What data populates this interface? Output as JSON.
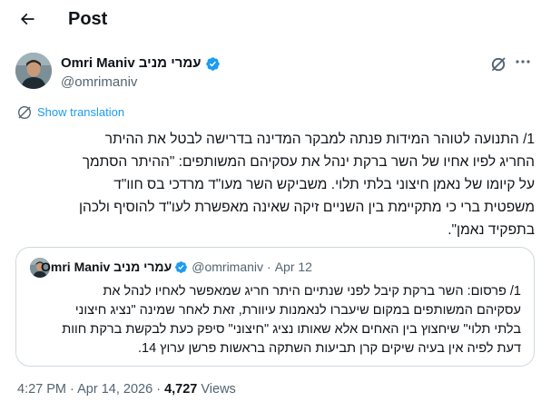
{
  "header": {
    "title": "Post"
  },
  "author": {
    "display_name": "Omri Maniv עמרי מניב",
    "handle": "@omrimaniv"
  },
  "translate_label": "Show translation",
  "tweet": {
    "lines": [
      "1/ התנועה לטוהר המידות פנתה למבקר המדינה בדרישה לבטל את ההיתר",
      "החריג לפיו אחיו של השר ברקת ינהל את עסקיהם המשותפים: \"ההיתר הסתמך",
      "על קיומו של נאמן חיצוני בלתי תלוי. משביקש השר מעו\"ד מרדכי בס חוו\"ד",
      "משפטית ברי כי מתקיימת בין השניים זיקה שאינה מאפשרת לעו\"ד להוסיף ולכהן",
      "בתפקיד נאמן\"."
    ]
  },
  "quote": {
    "display_name": "Omri Maniv עמרי מניב",
    "handle": "@omrimaniv",
    "separator": "·",
    "date": "Apr 12",
    "lines": [
      "1/ פרסום: השר ברקת קיבל לפני שנתיים היתר חריג שמאפשר לאחיו לנהל את",
      "עסקיהם המשותפים במקום שיעברו לנאמנות עיוורת, זאת לאחר שמינה \"נציג חיצוני",
      "בלתי תלוי\" שיחצוץ בין האחים אלא שאותו נציג \"חיצוני\" סיפק כעת לבקשת ברקת חוות",
      "דעת לפיה אין בעיה שיקים קרן תביעות השתקה בראשות פרשן ערוץ 14."
    ]
  },
  "meta": {
    "time": "4:27 PM",
    "separator": "·",
    "date": "Apr 14, 2026",
    "views_count": "4,727",
    "views_label": "Views"
  },
  "colors": {
    "accent": "#1d9bf0",
    "text": "#0f1419",
    "secondary": "#536471",
    "border": "#cfd9de"
  },
  "icons": [
    "back-arrow-icon",
    "verified-badge-icon",
    "grok-icon",
    "more-icon",
    "translate-globe-icon"
  ]
}
